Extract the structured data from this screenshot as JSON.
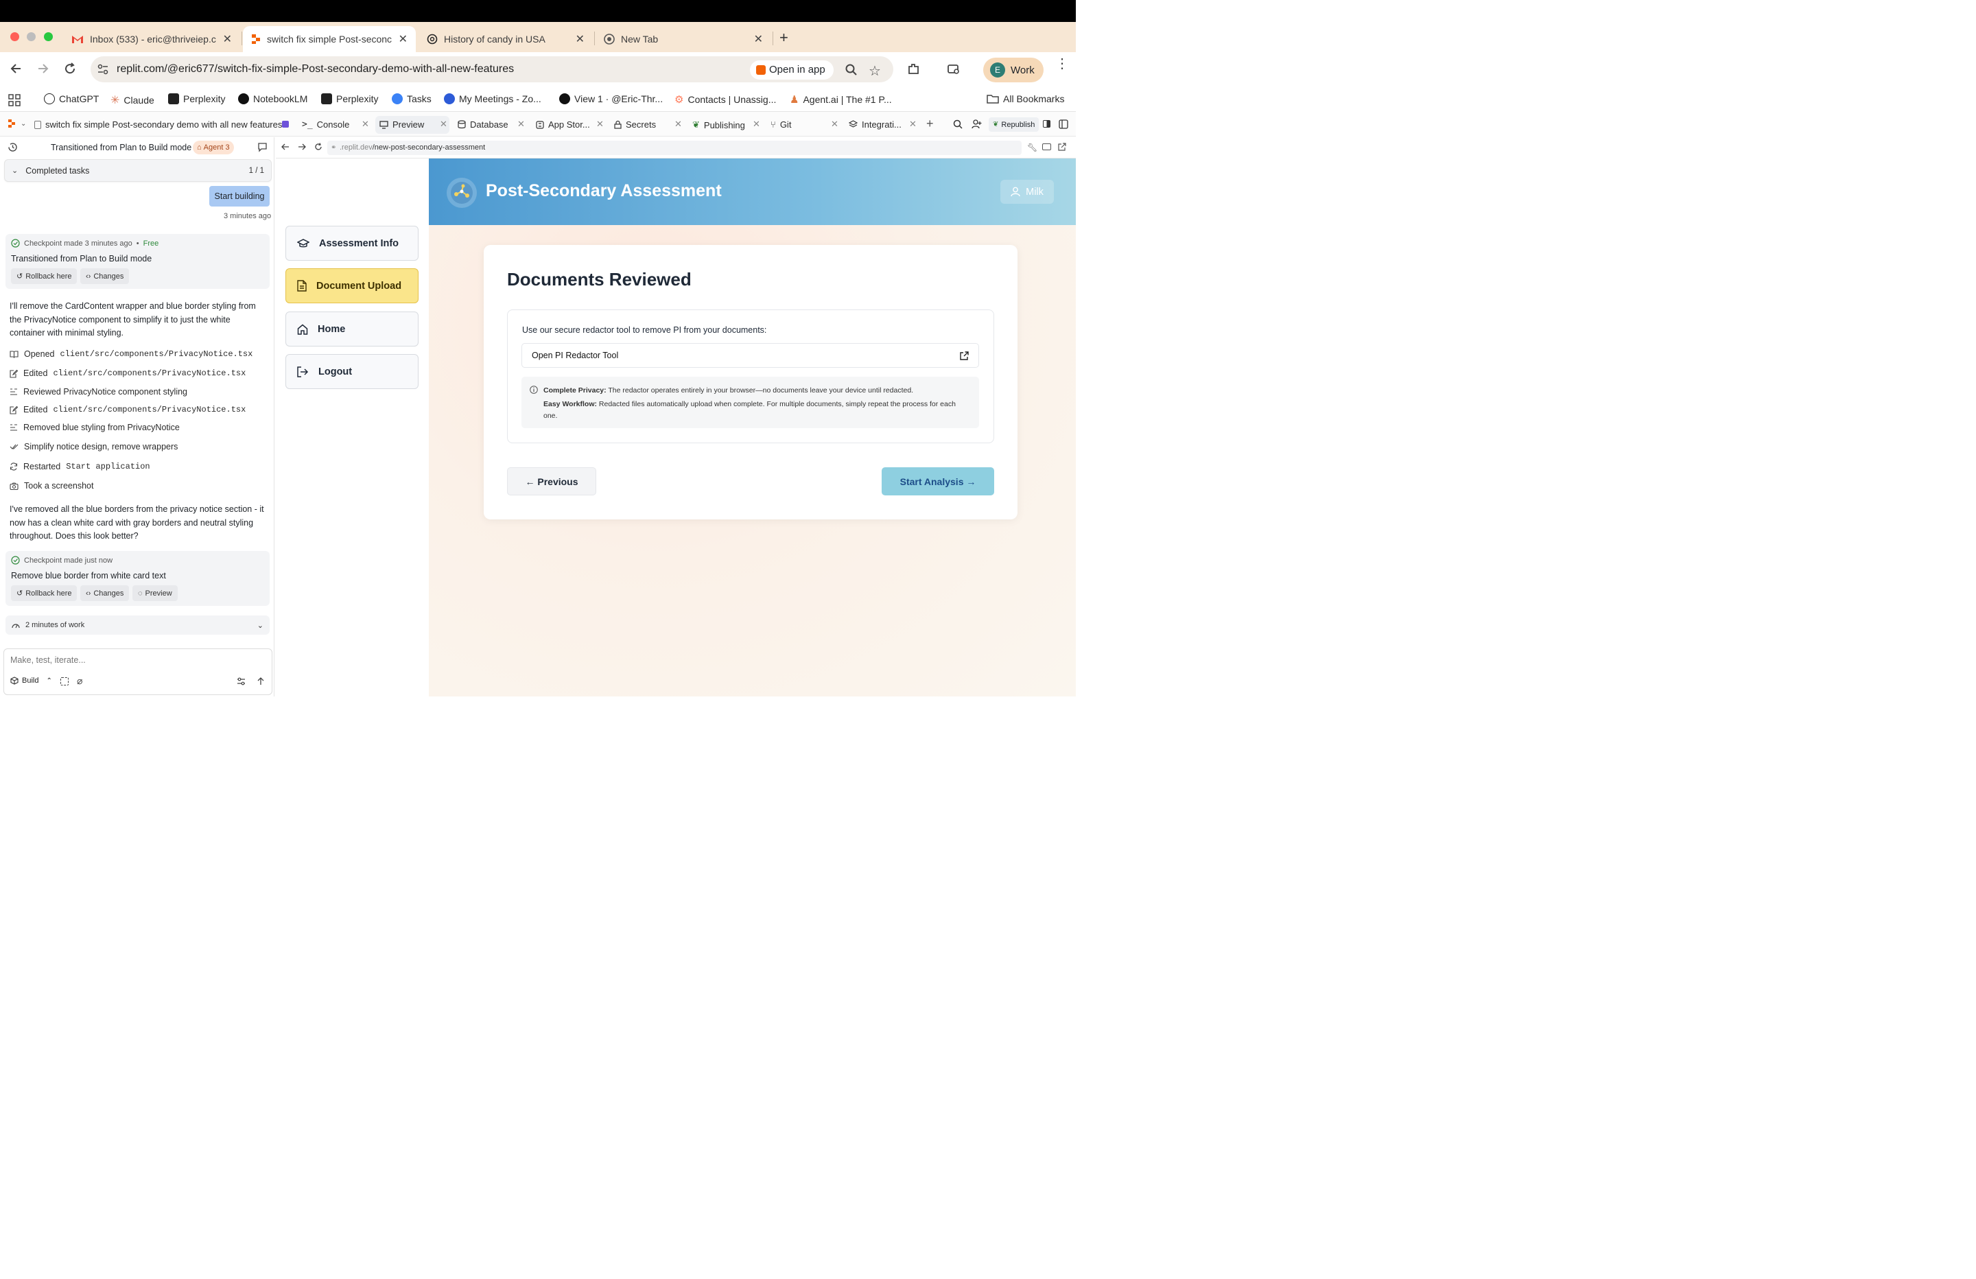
{
  "browser": {
    "tabs": [
      {
        "title": "Inbox (533) - eric@thriveiep.c",
        "icon": "gmail-icon"
      },
      {
        "title": "switch fix simple Post-seconc",
        "icon": "replit-icon"
      },
      {
        "title": "History of candy in USA",
        "icon": "chatgpt-icon"
      },
      {
        "title": "New Tab",
        "icon": "chrome-icon"
      }
    ],
    "url": "replit.com/@eric677/switch-fix-simple-Post-secondary-demo-with-all-new-features",
    "open_in_app": "Open in app",
    "profile_initial": "E",
    "profile_label": "Work",
    "bookmarks": [
      "ChatGPT",
      "Claude",
      "Perplexity",
      "NotebookLM",
      "Perplexity",
      "Tasks",
      "My Meetings - Zo...",
      "View 1 · @Eric-Thr...",
      "Contacts | Unassig...",
      "Agent.ai | The #1 P..."
    ],
    "all_bookmarks": "All Bookmarks"
  },
  "replit": {
    "project_title": "switch fix simple Post-secondary demo with all new features",
    "tabs": [
      "Console",
      "Preview",
      "Database",
      "App Stor...",
      "Secrets",
      "Publishing",
      "Git",
      "Integrati..."
    ],
    "republish": "Republish"
  },
  "agent": {
    "header_title": "Transitioned from Plan to Build mode",
    "agent_badge": "Agent 3",
    "completed_tasks": "Completed tasks",
    "completed_count": "1 / 1",
    "user_message": "Start building",
    "user_time": "3 minutes ago",
    "checkpoint1": {
      "meta": "Checkpoint made 3 minutes ago",
      "free": "Free",
      "title": "Transitioned from Plan to Build mode",
      "rollback": "Rollback here",
      "changes": "Changes"
    },
    "message1": "I'll remove the CardContent wrapper and blue border styling from the PrivacyNotice component to simplify it to just the white container with minimal styling.",
    "actions": [
      {
        "verb": "Opened",
        "target": "client/src/components/PrivacyNotice.tsx"
      },
      {
        "verb": "Edited",
        "target": "client/src/components/PrivacyNotice.tsx"
      },
      {
        "verb": "Reviewed PrivacyNotice component styling",
        "target": ""
      },
      {
        "verb": "Edited",
        "target": "client/src/components/PrivacyNotice.tsx"
      },
      {
        "verb": "Removed blue styling from PrivacyNotice",
        "target": ""
      },
      {
        "verb": "Simplify notice design, remove wrappers",
        "target": ""
      },
      {
        "verb": "Restarted",
        "target": "Start application"
      },
      {
        "verb": "Took a screenshot",
        "target": ""
      }
    ],
    "message2": "I've removed all the blue borders from the privacy notice section - it now has a clean white card with gray borders and neutral styling throughout. Does this look better?",
    "checkpoint2": {
      "meta": "Checkpoint made just now",
      "title": "Remove blue border from white card text",
      "rollback": "Rollback here",
      "changes": "Changes",
      "preview": "Preview"
    },
    "work_time": "2 minutes of work",
    "input_placeholder": "Make, test, iterate...",
    "build_label": "Build"
  },
  "preview": {
    "url_domain": ".replit.dev",
    "url_path": "/new-post-secondary-assessment",
    "app_title": "Post-Secondary Assessment",
    "user_name": "Milk",
    "nav": [
      "Assessment Info",
      "Document Upload",
      "Home",
      "Logout"
    ],
    "active_nav": "Document Upload",
    "heading": "Documents Reviewed",
    "redactor_prompt": "Use our secure redactor tool to remove PI from your documents:",
    "redactor_link": "Open PI Redactor Tool",
    "privacy_label": "Complete Privacy:",
    "privacy_text": "The redactor operates entirely in your browser—no documents leave your device until redacted.",
    "workflow_label": "Easy Workflow:",
    "workflow_text": "Redacted files automatically upload when complete. For multiple documents, simply repeat the process for each one.",
    "previous": "← Previous",
    "start_analysis": "Start Analysis →"
  },
  "colors": {
    "accent_yellow": "#fae58b",
    "header_blue": "#4b98d0",
    "start_button": "#8ecfe0"
  }
}
